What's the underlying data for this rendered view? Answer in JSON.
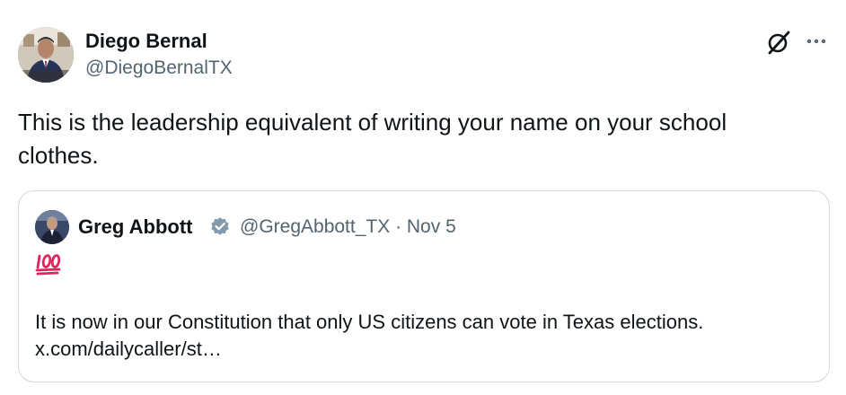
{
  "tweet": {
    "author": {
      "name": "Diego Bernal",
      "handle": "@DiegoBernalTX",
      "avatar_icon": "profile-photo"
    },
    "icons": {
      "grok": "x-grok-icon",
      "more": "more-options-icon"
    },
    "text": "This is the leadership equivalent of writing your name on your school clothes."
  },
  "quote": {
    "author": {
      "name": "Greg Abbott",
      "handle": "@GregAbbott_TX",
      "verified_icon": "verified-badge-icon",
      "verified_color": "#829aab"
    },
    "meta": "@GregAbbott_TX · Nov 5",
    "emoji": "💯",
    "emoji_color": "#e0245e",
    "text_line1": "It is now in our Constitution that only US citizens can vote in Texas elections.",
    "text_line2": "x.com/dailycaller/st…"
  },
  "colors": {
    "text": "#0f1419",
    "secondary": "#536471",
    "border": "#cfd9de"
  }
}
